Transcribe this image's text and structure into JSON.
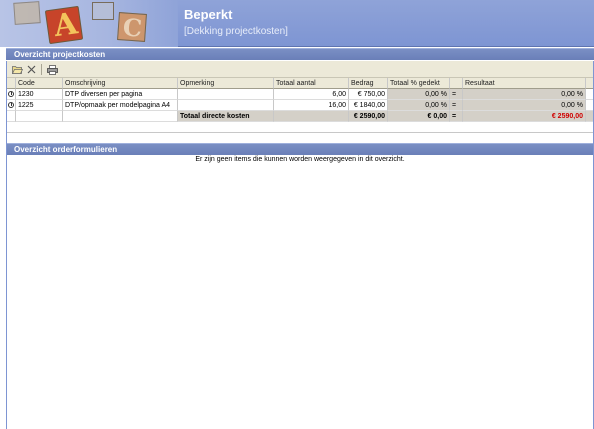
{
  "header": {
    "title": "Beperkt",
    "subtitle": "[Dekking projectkosten]",
    "logo_letters": [
      "A",
      "C"
    ]
  },
  "section_projectkosten": {
    "title": "Overzicht projectkosten",
    "toolbar": {
      "open_icon": "folder-open-icon",
      "delete_icon": "delete-icon",
      "print_icon": "printer-icon"
    },
    "columns": {
      "code": "Code",
      "omschrijving": "Omschrijving",
      "opmerking": "Opmerking",
      "totaal_aantal": "Totaal aantal",
      "bedrag": "Bedrag",
      "totaal_gedekt": "Totaal % gedekt",
      "resultaat": "Resultaat"
    },
    "rows": [
      {
        "code": "1230",
        "omschrijving": "DTP diversen per pagina",
        "opmerking": "",
        "totaal_aantal": "6,00",
        "bedrag": "€ 750,00",
        "totaal_gedekt": "0,00 %",
        "operator": "=",
        "resultaat": "0,00 %"
      },
      {
        "code": "1225",
        "omschrijving": "DTP/opmaak per modelpagina A4",
        "opmerking": "",
        "totaal_aantal": "16,00",
        "bedrag": "€ 1840,00",
        "totaal_gedekt": "0,00 %",
        "operator": "=",
        "resultaat": "0,00 %"
      }
    ],
    "total": {
      "label": "Totaal directe kosten",
      "bedrag": "€ 2590,00",
      "gedekt": "€ 0,00",
      "operator": "=",
      "resultaat": "€ 2590,00"
    }
  },
  "section_orderformulieren": {
    "title": "Overzicht orderformulieren",
    "empty_message": "Er zijn geen items die kunnen worden weergegeven in dit overzicht."
  },
  "colors": {
    "header_blue": "#7e95d3",
    "section_bar": "#6a7fb8",
    "total_red": "#d00000",
    "grid_gray": "#d4d0c8"
  }
}
